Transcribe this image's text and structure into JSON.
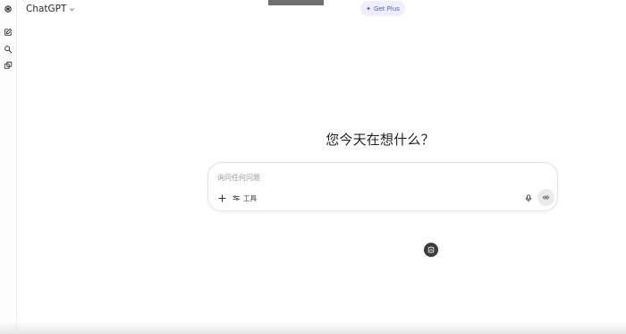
{
  "header": {
    "model_name": "ChatGPT",
    "get_plus_label": "Get Plus"
  },
  "sidebar": {
    "items": [
      {
        "icon": "openai-logo-icon"
      },
      {
        "icon": "new-chat-icon"
      },
      {
        "icon": "search-icon"
      },
      {
        "icon": "library-icon"
      }
    ]
  },
  "main": {
    "headline": "您今天在想什么？"
  },
  "composer": {
    "placeholder": "询问任何问题",
    "tools_label": "工具",
    "icons": [
      "plus-icon",
      "tools-icon",
      "microphone-icon",
      "voice-mode-icon"
    ]
  },
  "colors": {
    "accent": "#5a5bd6",
    "accent_bg": "#eeeefc",
    "float_button": "#3c3c3c"
  }
}
